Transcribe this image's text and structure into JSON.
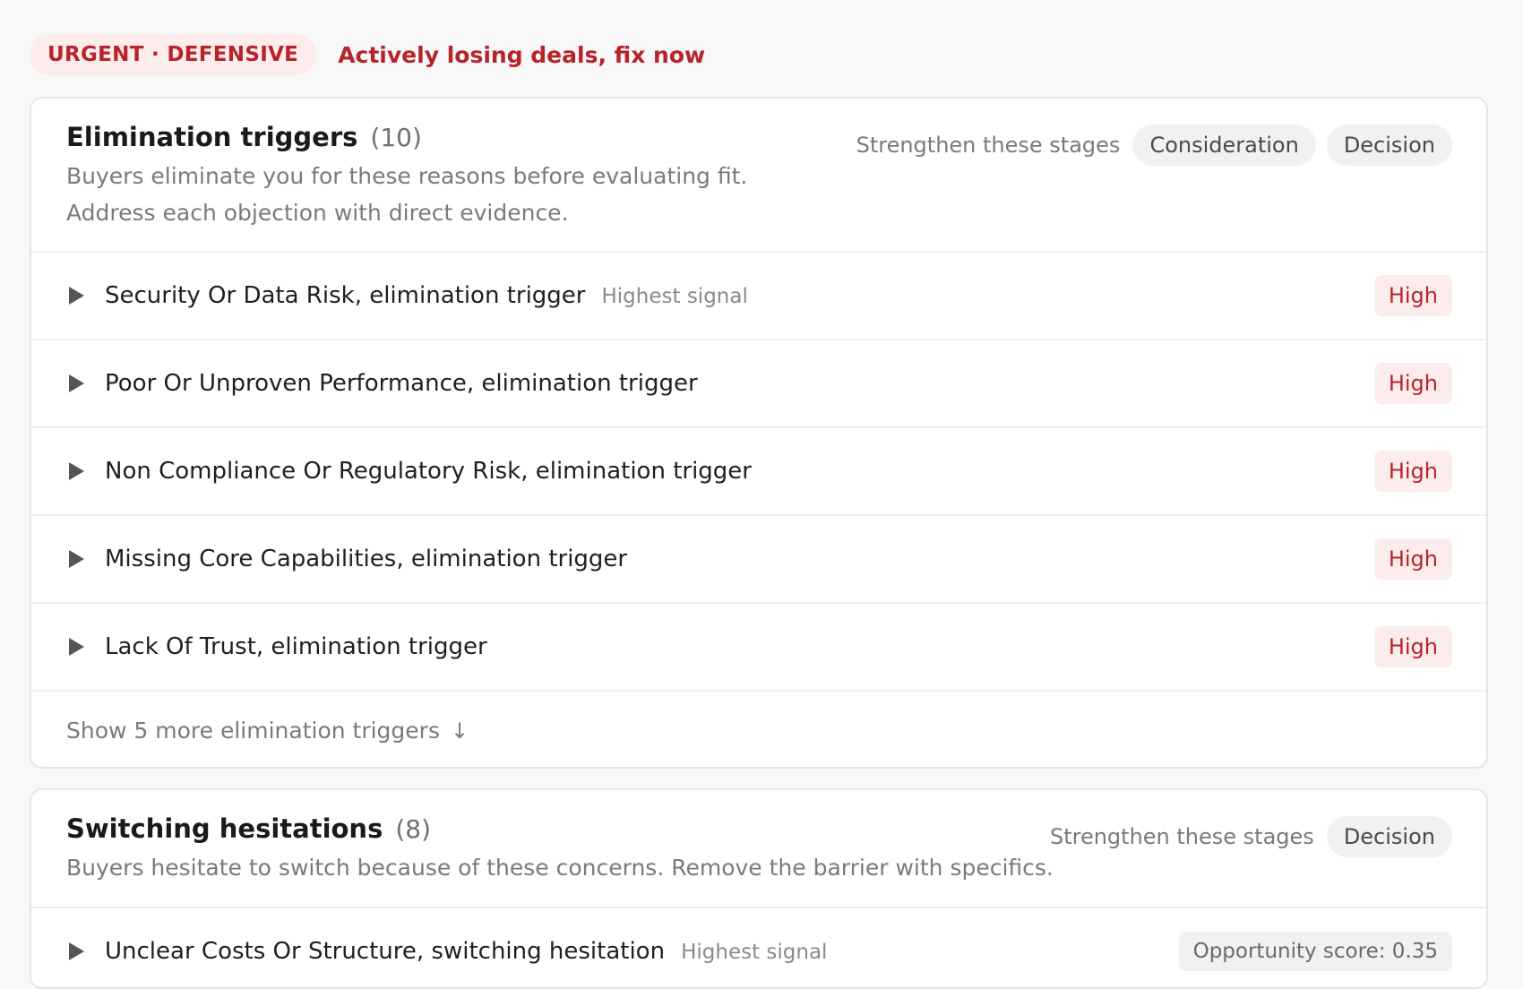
{
  "header": {
    "badge": "URGENT · DEFENSIVE",
    "message": "Actively losing deals, fix now"
  },
  "sections": [
    {
      "title": "Elimination triggers",
      "count": "(10)",
      "description": "Buyers eliminate you for these reasons before evaluating fit. Address each objection with direct evidence.",
      "stages_label": "Strengthen these stages",
      "stages": [
        "Consideration",
        "Decision"
      ],
      "items": [
        {
          "label": "Security Or Data Risk, elimination trigger",
          "hint": "Highest signal",
          "level": "High"
        },
        {
          "label": "Poor Or Unproven Performance, elimination trigger",
          "level": "High"
        },
        {
          "label": "Non Compliance Or Regulatory Risk, elimination trigger",
          "level": "High"
        },
        {
          "label": "Missing Core Capabilities, elimination trigger",
          "level": "High"
        },
        {
          "label": "Lack Of Trust, elimination trigger",
          "level": "High"
        }
      ],
      "show_more": "Show 5 more elimination triggers"
    },
    {
      "title": "Switching hesitations",
      "count": "(8)",
      "description": "Buyers hesitate to switch because of these concerns. Remove the barrier with specifics.",
      "stages_label": "Strengthen these stages",
      "stages": [
        "Decision"
      ],
      "items": [
        {
          "label": "Unclear Costs Or Structure, switching hesitation",
          "hint": "Highest signal",
          "score": "Opportunity score: 0.35"
        }
      ]
    }
  ],
  "colors": {
    "urgent": "#b8232a",
    "urgent_bg": "#fdecec",
    "pill_bg": "#f1f1f1"
  },
  "icons": {
    "row_toggle": "caret-right-icon",
    "show_more": "arrow-down-icon"
  }
}
